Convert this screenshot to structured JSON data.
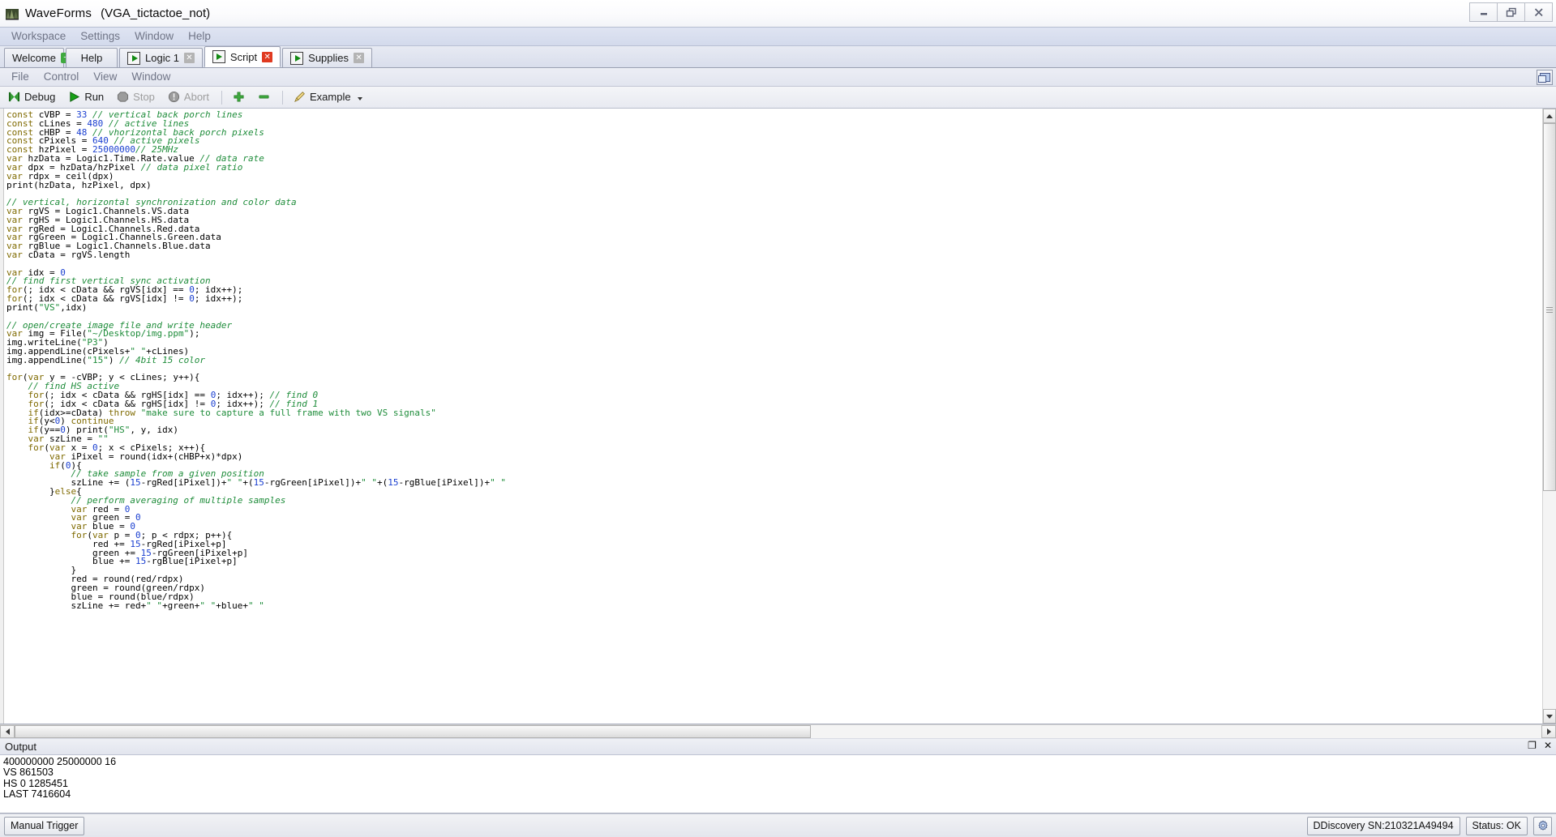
{
  "window": {
    "app_title": "WaveForms",
    "project": "(VGA_tictactoe_not)",
    "app_icon": "waveforms-logo-icon",
    "minimize": "minimize-icon",
    "restore": "restore-icon",
    "close": "close-icon"
  },
  "main_menu": [
    {
      "label": "Workspace"
    },
    {
      "label": "Settings"
    },
    {
      "label": "Window"
    },
    {
      "label": "Help"
    }
  ],
  "tabs": [
    {
      "label": "Welcome",
      "icon": "plus-icon",
      "active": false
    },
    {
      "label": "Help",
      "icon": "",
      "active": false
    },
    {
      "label": "Logic 1",
      "icon": "run-icon",
      "close": "close-icon",
      "active": false
    },
    {
      "label": "Script",
      "icon": "run-icon",
      "close": "close-icon-red",
      "active": true
    },
    {
      "label": "Supplies",
      "icon": "run-icon",
      "close": "close-icon",
      "active": false
    }
  ],
  "script_menu": [
    {
      "label": "File"
    },
    {
      "label": "Control"
    },
    {
      "label": "View"
    },
    {
      "label": "Window"
    }
  ],
  "script_menu_right_icon": "float-window-icon",
  "toolbar": {
    "debug": "Debug",
    "run": "Run",
    "stop": "Stop",
    "abort": "Abort",
    "add": "plus-icon",
    "remove": "minus-icon",
    "example": "Example",
    "example_icon": "pencil-icon"
  },
  "editor": {
    "lines": [
      [
        {
          "t": "const ",
          "c": "k"
        },
        {
          "t": "cVBP = "
        },
        {
          "t": "33",
          "c": "n"
        },
        {
          "t": " // vertical back porch lines",
          "c": "c"
        }
      ],
      [
        {
          "t": "const ",
          "c": "k"
        },
        {
          "t": "cLines = "
        },
        {
          "t": "480",
          "c": "n"
        },
        {
          "t": " // active lines",
          "c": "c"
        }
      ],
      [
        {
          "t": "const ",
          "c": "k"
        },
        {
          "t": "cHBP = "
        },
        {
          "t": "48",
          "c": "n"
        },
        {
          "t": " // vhorizontal back porch pixels",
          "c": "c"
        }
      ],
      [
        {
          "t": "const ",
          "c": "k"
        },
        {
          "t": "cPixels = "
        },
        {
          "t": "640",
          "c": "n"
        },
        {
          "t": " // active pixels",
          "c": "c"
        }
      ],
      [
        {
          "t": "const ",
          "c": "k"
        },
        {
          "t": "hzPixel = "
        },
        {
          "t": "25000000",
          "c": "n"
        },
        {
          "t": "// 25MHz",
          "c": "c"
        }
      ],
      [
        {
          "t": "var ",
          "c": "k"
        },
        {
          "t": "hzData = Logic1.Time.Rate.value "
        },
        {
          "t": "// data rate",
          "c": "c"
        }
      ],
      [
        {
          "t": "var ",
          "c": "k"
        },
        {
          "t": "dpx = hzData/hzPixel "
        },
        {
          "t": "// data pixel ratio",
          "c": "c"
        }
      ],
      [
        {
          "t": "var ",
          "c": "k"
        },
        {
          "t": "rdpx = ceil(dpx)"
        }
      ],
      [
        {
          "t": "print(hzData, hzPixel, dpx)"
        }
      ],
      [],
      [
        {
          "t": "// vertical, horizontal synchronization and color data",
          "c": "c"
        }
      ],
      [
        {
          "t": "var ",
          "c": "k"
        },
        {
          "t": "rgVS = Logic1.Channels.VS.data"
        }
      ],
      [
        {
          "t": "var ",
          "c": "k"
        },
        {
          "t": "rgHS = Logic1.Channels.HS.data"
        }
      ],
      [
        {
          "t": "var ",
          "c": "k"
        },
        {
          "t": "rgRed = Logic1.Channels.Red.data"
        }
      ],
      [
        {
          "t": "var ",
          "c": "k"
        },
        {
          "t": "rgGreen = Logic1.Channels.Green.data"
        }
      ],
      [
        {
          "t": "var ",
          "c": "k"
        },
        {
          "t": "rgBlue = Logic1.Channels.Blue.data"
        }
      ],
      [
        {
          "t": "var ",
          "c": "k"
        },
        {
          "t": "cData = rgVS.length"
        }
      ],
      [],
      [
        {
          "t": "var ",
          "c": "k"
        },
        {
          "t": "idx = "
        },
        {
          "t": "0",
          "c": "n"
        }
      ],
      [
        {
          "t": "// find first vertical sync activation",
          "c": "c"
        }
      ],
      [
        {
          "t": "for",
          "c": "k"
        },
        {
          "t": "(; idx < cData && rgVS[idx] == "
        },
        {
          "t": "0",
          "c": "n"
        },
        {
          "t": "; idx++);"
        }
      ],
      [
        {
          "t": "for",
          "c": "k"
        },
        {
          "t": "(; idx < cData && rgVS[idx] != "
        },
        {
          "t": "0",
          "c": "n"
        },
        {
          "t": "; idx++);"
        }
      ],
      [
        {
          "t": "print("
        },
        {
          "t": "\"VS\"",
          "c": "s"
        },
        {
          "t": ",idx)"
        }
      ],
      [],
      [
        {
          "t": "// open/create image file and write header",
          "c": "c"
        }
      ],
      [
        {
          "t": "var ",
          "c": "k"
        },
        {
          "t": "img = File("
        },
        {
          "t": "\"~/Desktop/img.ppm\"",
          "c": "s"
        },
        {
          "t": ");"
        }
      ],
      [
        {
          "t": "img.writeLine("
        },
        {
          "t": "\"P3\"",
          "c": "s"
        },
        {
          "t": ")"
        }
      ],
      [
        {
          "t": "img.appendLine(cPixels+"
        },
        {
          "t": "\" \"",
          "c": "s"
        },
        {
          "t": "+cLines)"
        }
      ],
      [
        {
          "t": "img.appendLine("
        },
        {
          "t": "\"15\"",
          "c": "s"
        },
        {
          "t": ") "
        },
        {
          "t": "// 4bit 15 color",
          "c": "c"
        }
      ],
      [],
      [
        {
          "t": "for",
          "c": "k"
        },
        {
          "t": "("
        },
        {
          "t": "var ",
          "c": "k"
        },
        {
          "t": "y = -cVBP; y < cLines; y++){"
        }
      ],
      [
        {
          "t": "    // find HS active",
          "c": "c"
        }
      ],
      [
        {
          "t": "    "
        },
        {
          "t": "for",
          "c": "k"
        },
        {
          "t": "(; idx < cData && rgHS[idx] == "
        },
        {
          "t": "0",
          "c": "n"
        },
        {
          "t": "; idx++); "
        },
        {
          "t": "// find 0",
          "c": "c"
        }
      ],
      [
        {
          "t": "    "
        },
        {
          "t": "for",
          "c": "k"
        },
        {
          "t": "(; idx < cData && rgHS[idx] != "
        },
        {
          "t": "0",
          "c": "n"
        },
        {
          "t": "; idx++); "
        },
        {
          "t": "// find 1",
          "c": "c"
        }
      ],
      [
        {
          "t": "    "
        },
        {
          "t": "if",
          "c": "k"
        },
        {
          "t": "(idx>=cData) "
        },
        {
          "t": "throw ",
          "c": "k"
        },
        {
          "t": "\"make sure to capture a full frame with two VS signals\"",
          "c": "s"
        }
      ],
      [
        {
          "t": "    "
        },
        {
          "t": "if",
          "c": "k"
        },
        {
          "t": "(y<"
        },
        {
          "t": "0",
          "c": "n"
        },
        {
          "t": ") "
        },
        {
          "t": "continue",
          "c": "k"
        }
      ],
      [
        {
          "t": "    "
        },
        {
          "t": "if",
          "c": "k"
        },
        {
          "t": "(y=="
        },
        {
          "t": "0",
          "c": "n"
        },
        {
          "t": ") print("
        },
        {
          "t": "\"HS\"",
          "c": "s"
        },
        {
          "t": ", y, idx)"
        }
      ],
      [
        {
          "t": "    "
        },
        {
          "t": "var ",
          "c": "k"
        },
        {
          "t": "szLine = "
        },
        {
          "t": "\"\"",
          "c": "s"
        }
      ],
      [
        {
          "t": "    "
        },
        {
          "t": "for",
          "c": "k"
        },
        {
          "t": "("
        },
        {
          "t": "var ",
          "c": "k"
        },
        {
          "t": "x = "
        },
        {
          "t": "0",
          "c": "n"
        },
        {
          "t": "; x < cPixels; x++){"
        }
      ],
      [
        {
          "t": "        "
        },
        {
          "t": "var ",
          "c": "k"
        },
        {
          "t": "iPixel = round(idx+(cHBP+x)*dpx)"
        }
      ],
      [
        {
          "t": "        "
        },
        {
          "t": "if",
          "c": "k"
        },
        {
          "t": "("
        },
        {
          "t": "0",
          "c": "n"
        },
        {
          "t": "){"
        }
      ],
      [
        {
          "t": "            // take sample from a given position",
          "c": "c"
        }
      ],
      [
        {
          "t": "            szLine += ("
        },
        {
          "t": "15",
          "c": "n"
        },
        {
          "t": "-rgRed[iPixel])+"
        },
        {
          "t": "\" \"",
          "c": "s"
        },
        {
          "t": "+("
        },
        {
          "t": "15",
          "c": "n"
        },
        {
          "t": "-rgGreen[iPixel])+"
        },
        {
          "t": "\" \"",
          "c": "s"
        },
        {
          "t": "+("
        },
        {
          "t": "15",
          "c": "n"
        },
        {
          "t": "-rgBlue[iPixel])+"
        },
        {
          "t": "\" \"",
          "c": "s"
        }
      ],
      [
        {
          "t": "        }"
        },
        {
          "t": "else",
          "c": "k"
        },
        {
          "t": "{"
        }
      ],
      [
        {
          "t": "            // perform averaging of multiple samples",
          "c": "c"
        }
      ],
      [
        {
          "t": "            "
        },
        {
          "t": "var ",
          "c": "k"
        },
        {
          "t": "red = "
        },
        {
          "t": "0",
          "c": "n"
        }
      ],
      [
        {
          "t": "            "
        },
        {
          "t": "var ",
          "c": "k"
        },
        {
          "t": "green = "
        },
        {
          "t": "0",
          "c": "n"
        }
      ],
      [
        {
          "t": "            "
        },
        {
          "t": "var ",
          "c": "k"
        },
        {
          "t": "blue = "
        },
        {
          "t": "0",
          "c": "n"
        }
      ],
      [
        {
          "t": "            "
        },
        {
          "t": "for",
          "c": "k"
        },
        {
          "t": "("
        },
        {
          "t": "var ",
          "c": "k"
        },
        {
          "t": "p = "
        },
        {
          "t": "0",
          "c": "n"
        },
        {
          "t": "; p < rdpx; p++){"
        }
      ],
      [
        {
          "t": "                red += "
        },
        {
          "t": "15",
          "c": "n"
        },
        {
          "t": "-rgRed[iPixel+p]"
        }
      ],
      [
        {
          "t": "                green += "
        },
        {
          "t": "15",
          "c": "n"
        },
        {
          "t": "-rgGreen[iPixel+p]"
        }
      ],
      [
        {
          "t": "                blue += "
        },
        {
          "t": "15",
          "c": "n"
        },
        {
          "t": "-rgBlue[iPixel+p]"
        }
      ],
      [
        {
          "t": "            }"
        }
      ],
      [
        {
          "t": "            red = round(red/rdpx)"
        }
      ],
      [
        {
          "t": "            green = round(green/rdpx)"
        }
      ],
      [
        {
          "t": "            blue = round(blue/rdpx)"
        }
      ],
      [
        {
          "t": "            szLine += red+"
        },
        {
          "t": "\" \"",
          "c": "s"
        },
        {
          "t": "+green+"
        },
        {
          "t": "\" \"",
          "c": "s"
        },
        {
          "t": "+blue+"
        },
        {
          "t": "\" \"",
          "c": "s"
        }
      ]
    ]
  },
  "output": {
    "title": "Output",
    "float_icon": "float-icon",
    "close_icon": "close-icon",
    "lines": [
      "400000000 25000000 16",
      "VS 861503",
      "HS 0 1285451",
      "LAST 7416604"
    ]
  },
  "statusbar": {
    "manual_trigger": "Manual Trigger",
    "device": "DDiscovery SN:210321A49494",
    "status": "Status: OK",
    "settings_icon": "gear-icon"
  },
  "colors": {
    "keyword": "#7f6a00",
    "number": "#1a3fd0",
    "comment": "#1e8c3a",
    "string": "#1e8c3a",
    "accent_green": "#3faa3f",
    "accent_red": "#e03a20"
  }
}
